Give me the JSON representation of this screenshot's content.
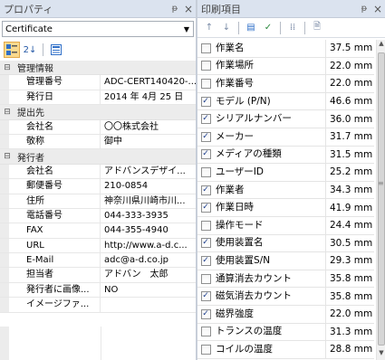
{
  "properties_pane": {
    "title": "プロパティ",
    "pin_glyph": "ᵽ",
    "close_glyph": "×",
    "object_selector": {
      "value": "Certificate"
    },
    "toolbar": {
      "categorized_icon": "categorized-icon",
      "sort_icon_label": "2↓",
      "pages_icon": "property-pages-icon"
    },
    "groups": [
      {
        "name": "管理情報",
        "rows": [
          {
            "key": "管理番号",
            "value": "ADC-CERT140420-..."
          },
          {
            "key": "発行日",
            "value": "2014 年 4月 25 日"
          }
        ]
      },
      {
        "name": "提出先",
        "rows": [
          {
            "key": "会社名",
            "value": "〇〇株式会社"
          },
          {
            "key": "敬称",
            "value": "御中"
          }
        ]
      },
      {
        "name": "発行者",
        "rows": [
          {
            "key": "会社名",
            "value": "アドバンスデザイ..."
          },
          {
            "key": "郵便番号",
            "value": "210-0854"
          },
          {
            "key": "住所",
            "value": "神奈川県川崎市川..."
          },
          {
            "key": "電話番号",
            "value": "044-333-3935"
          },
          {
            "key": "FAX",
            "value": "044-355-4940"
          },
          {
            "key": "URL",
            "value": "http://www.a-d.c..."
          },
          {
            "key": "E-Mail",
            "value": "adc@a-d.co.jp"
          },
          {
            "key": "担当者",
            "value": "アドバン　太郎"
          },
          {
            "key": "発行者に画像...",
            "value": "NO"
          },
          {
            "key": "イメージファ...",
            "value": ""
          }
        ]
      }
    ]
  },
  "print_items_pane": {
    "title": "印刷項目",
    "pin_glyph": "ᵽ",
    "close_glyph": "×",
    "toolbar": [
      "↑",
      "↓",
      "▤",
      "✓",
      "⁞⁞",
      "🗎"
    ],
    "items": [
      {
        "name": "作業名",
        "size": "37.5 mm",
        "checked": false
      },
      {
        "name": "作業場所",
        "size": "22.0 mm",
        "checked": false
      },
      {
        "name": "作業番号",
        "size": "22.0 mm",
        "checked": false
      },
      {
        "name": "モデル (P/N)",
        "size": "46.6 mm",
        "checked": true
      },
      {
        "name": "シリアルナンバー",
        "size": "36.0 mm",
        "checked": true
      },
      {
        "name": "メーカー",
        "size": "31.7 mm",
        "checked": true
      },
      {
        "name": "メディアの種類",
        "size": "31.5 mm",
        "checked": true
      },
      {
        "name": "ユーザーID",
        "size": "25.2 mm",
        "checked": false
      },
      {
        "name": "作業者",
        "size": "34.3 mm",
        "checked": true
      },
      {
        "name": "作業日時",
        "size": "41.9 mm",
        "checked": true
      },
      {
        "name": "操作モード",
        "size": "24.4 mm",
        "checked": false
      },
      {
        "name": "使用装置名",
        "size": "30.5 mm",
        "checked": true
      },
      {
        "name": "使用装置S/N",
        "size": "29.3 mm",
        "checked": true
      },
      {
        "name": "通算消去カウント",
        "size": "35.8 mm",
        "checked": false
      },
      {
        "name": "磁気消去カウント",
        "size": "35.8 mm",
        "checked": true
      },
      {
        "name": "磁界強度",
        "size": "22.0 mm",
        "checked": true
      },
      {
        "name": "トランスの温度",
        "size": "31.3 mm",
        "checked": false
      },
      {
        "name": "コイルの温度",
        "size": "28.8 mm",
        "checked": false
      }
    ]
  }
}
